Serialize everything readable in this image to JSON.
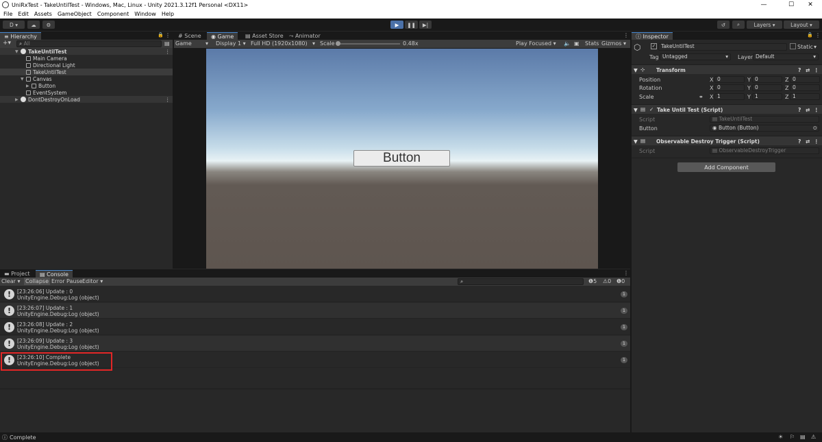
{
  "window": {
    "title": "UniRxTest - TakeUntilTest - Windows, Mac, Linux - Unity 2021.3.12f1 Personal <DX11>",
    "minimize": "—",
    "maximize": "☐",
    "close": "✕"
  },
  "menu": [
    "File",
    "Edit",
    "Assets",
    "GameObject",
    "Component",
    "Window",
    "Help"
  ],
  "toolbar": {
    "account": "D ▾",
    "layers": "Layers",
    "layout": "Layout"
  },
  "hierarchy": {
    "tab": "Hierarchy",
    "search_placeholder": "All",
    "items": [
      {
        "label": "TakeUntilTest"
      },
      {
        "label": "Main Camera"
      },
      {
        "label": "Directional Light"
      },
      {
        "label": "TakeUntilTest"
      },
      {
        "label": "Canvas"
      },
      {
        "label": "Button"
      },
      {
        "label": "EventSystem"
      },
      {
        "label": "DontDestroyOnLoad"
      }
    ]
  },
  "scene_tabs": [
    "Scene",
    "Game",
    "Asset Store",
    "Animator"
  ],
  "game_bar": {
    "mode": "Game",
    "display": "Display 1",
    "resolution": "Full HD (1920x1080)",
    "scale_label": "Scale",
    "scale_value": "0.48x",
    "play_focused": "Play Focused",
    "stats": "Stats",
    "gizmos": "Gizmos"
  },
  "game_button_label": "Button",
  "bottom_tabs": [
    "Project",
    "Console"
  ],
  "console_bar": {
    "clear": "Clear",
    "collapse": "Collapse",
    "error_pause": "Error Pause",
    "editor": "Editor",
    "log_count": "5",
    "warn_count": "0",
    "error_count": "0"
  },
  "console_entries": [
    {
      "line1": "[23:26:06] Update : 0",
      "line2": "UnityEngine.Debug:Log (object)",
      "count": "1"
    },
    {
      "line1": "[23:26:07] Update : 1",
      "line2": "UnityEngine.Debug:Log (object)",
      "count": "1"
    },
    {
      "line1": "[23:26:08] Update : 2",
      "line2": "UnityEngine.Debug:Log (object)",
      "count": "1"
    },
    {
      "line1": "[23:26:09] Update : 3",
      "line2": "UnityEngine.Debug:Log (object)",
      "count": "1"
    },
    {
      "line1": "[23:26:10] Complete",
      "line2": "UnityEngine.Debug:Log (object)",
      "count": "1"
    }
  ],
  "inspector": {
    "tab": "Inspector",
    "object_name": "TakeUntilTest",
    "static_label": "Static",
    "tag_label": "Tag",
    "tag_value": "Untagged",
    "layer_label": "Layer",
    "layer_value": "Default",
    "transform": {
      "title": "Transform",
      "position_label": "Position",
      "rotation_label": "Rotation",
      "scale_label": "Scale",
      "x": "X",
      "y": "Y",
      "z": "Z",
      "position": [
        "0",
        "0",
        "0"
      ],
      "rotation": [
        "0",
        "0",
        "0"
      ],
      "scale": [
        "1",
        "1",
        "1"
      ]
    },
    "take_until": {
      "title": "Take Until Test (Script)",
      "script_label": "Script",
      "script_value": "TakeUntilTest",
      "button_label": "Button",
      "button_value": "Button (Button)"
    },
    "observable": {
      "title": "Observable Destroy Trigger (Script)",
      "script_label": "Script",
      "script_value": "ObservableDestroyTrigger"
    },
    "add_component": "Add Component"
  },
  "status_text": "Complete",
  "colors": {
    "highlight": "#e32626",
    "play_active": "#4b71a8"
  }
}
